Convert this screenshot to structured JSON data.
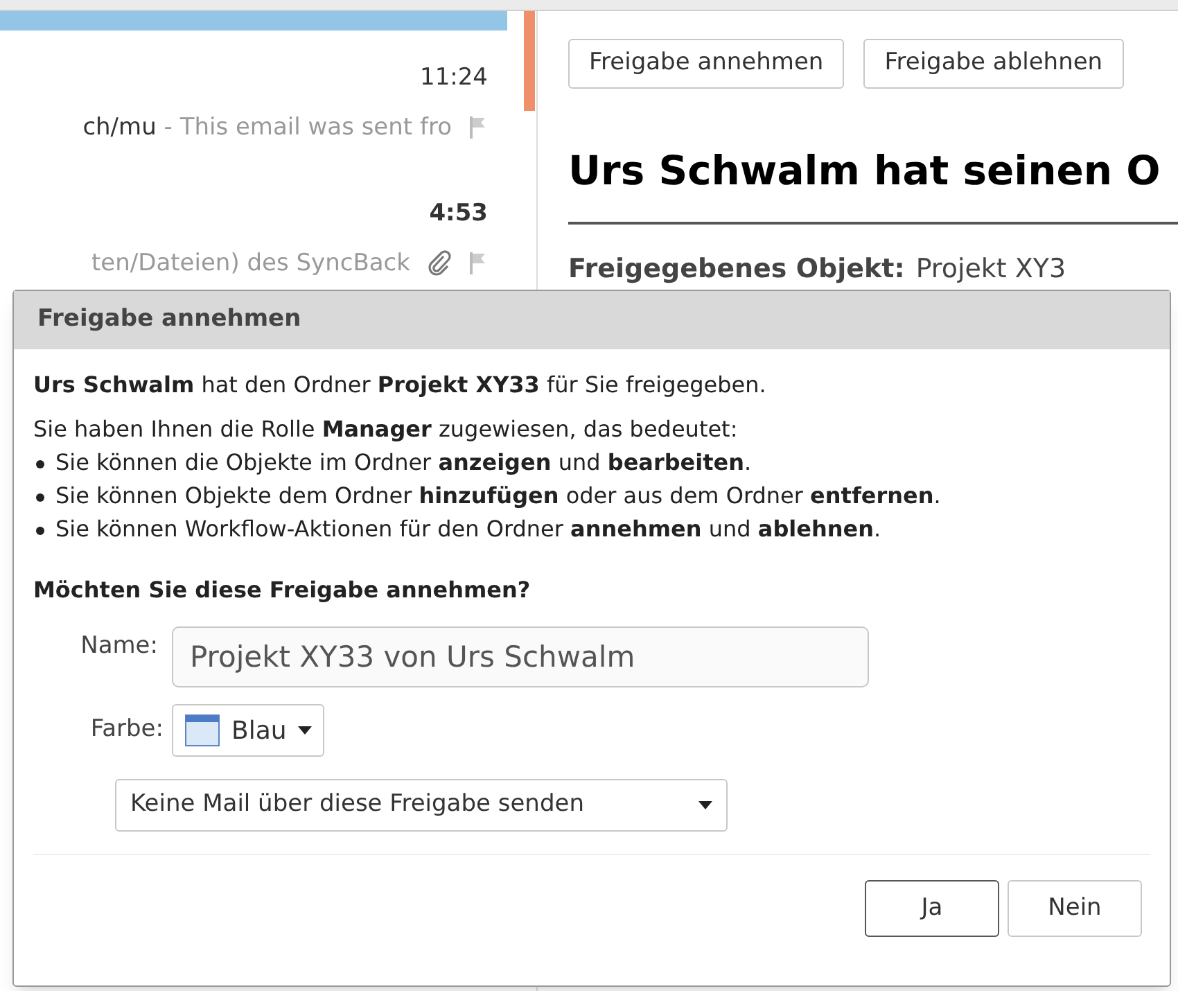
{
  "message_list": {
    "messages": [
      {
        "selected": true
      },
      {
        "selected": false,
        "unread": false,
        "time": "11:24",
        "sender": "ch/mu",
        "snippet": " - This email was sent fro",
        "attachment": false,
        "flagged": false
      },
      {
        "selected": false,
        "unread": true,
        "time": "4:53",
        "snippet": "ten/Dateien) des SyncBack",
        "attachment": true,
        "flagged": false
      }
    ]
  },
  "reading_pane": {
    "actions": [
      "Freigabe annehmen",
      "Freigabe ablehnen"
    ],
    "heading": "Urs Schwalm hat seinen O",
    "details": [
      {
        "label": "Freigegebenes Objekt:",
        "value": "Projekt XY3"
      }
    ]
  },
  "dialog": {
    "title": "Freigabe annehmen",
    "intro": "**Urs Schwalm** hat den Ordner **Projekt XY33** für Sie freigegeben.",
    "role_text": "Sie haben Ihnen die Rolle **Manager** zugewiesen, das bedeutet:",
    "permissions": [
      "Sie können die Objekte im Ordner **anzeigen** und **bearbeiten**.",
      "Sie können Objekte dem Ordner **hinzufügen** oder aus dem Ordner **entfernen**.",
      "Sie können Workflow-Aktionen für den Ordner **annehmen** und **ablehnen**."
    ],
    "question": "Möchten Sie diese Freigabe annehmen?",
    "name_label": "Name:",
    "name_value": "Projekt XY33 von Urs Schwalm",
    "color_label": "Farbe:",
    "color_value": "Blau",
    "mail_option": "Keine Mail über diese Freigabe senden",
    "buttons": [
      {
        "label": "Ja",
        "default": true
      },
      {
        "label": "Nein",
        "default": false
      }
    ]
  }
}
